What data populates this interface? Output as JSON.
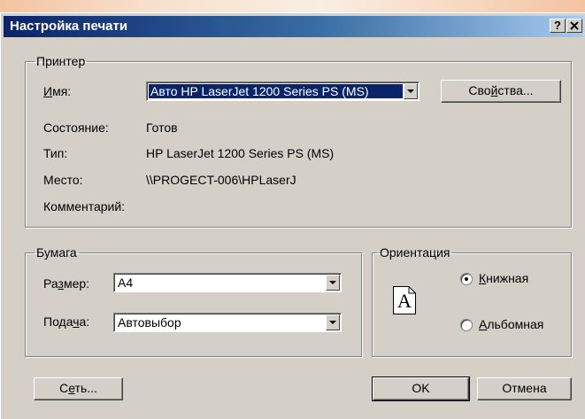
{
  "window": {
    "title": "Настройка печати",
    "help_button": "?",
    "close_button": "X"
  },
  "printer": {
    "group_label": "Принтер",
    "name_label": "Имя:",
    "name_value": "Авто HP LaserJet 1200 Series PS (MS)",
    "properties_button": "Свойства...",
    "status_label": "Состояние:",
    "status_value": "Готов",
    "type_label": "Тип:",
    "type_value": "HP LaserJet 1200 Series PS (MS)",
    "where_label": "Место:",
    "where_value": "\\\\PROGECT-006\\HPLaserJ",
    "comment_label": "Комментарий:",
    "comment_value": ""
  },
  "paper": {
    "group_label": "Бумага",
    "size_label": "Размер:",
    "size_value": "A4",
    "source_label": "Подача:",
    "source_value": "Автовыбор"
  },
  "orientation": {
    "group_label": "Ориентация",
    "page_letter": "A",
    "portrait_label": "Книжная",
    "landscape_label": "Альбомная",
    "selected": "portrait"
  },
  "buttons": {
    "network": "Сеть...",
    "ok": "OK",
    "cancel": "Отмена"
  },
  "colors": {
    "dialog_face": "#d4d0c8",
    "title_start": "#0a246a",
    "title_end": "#a6caf0",
    "selection": "#0a246a"
  }
}
